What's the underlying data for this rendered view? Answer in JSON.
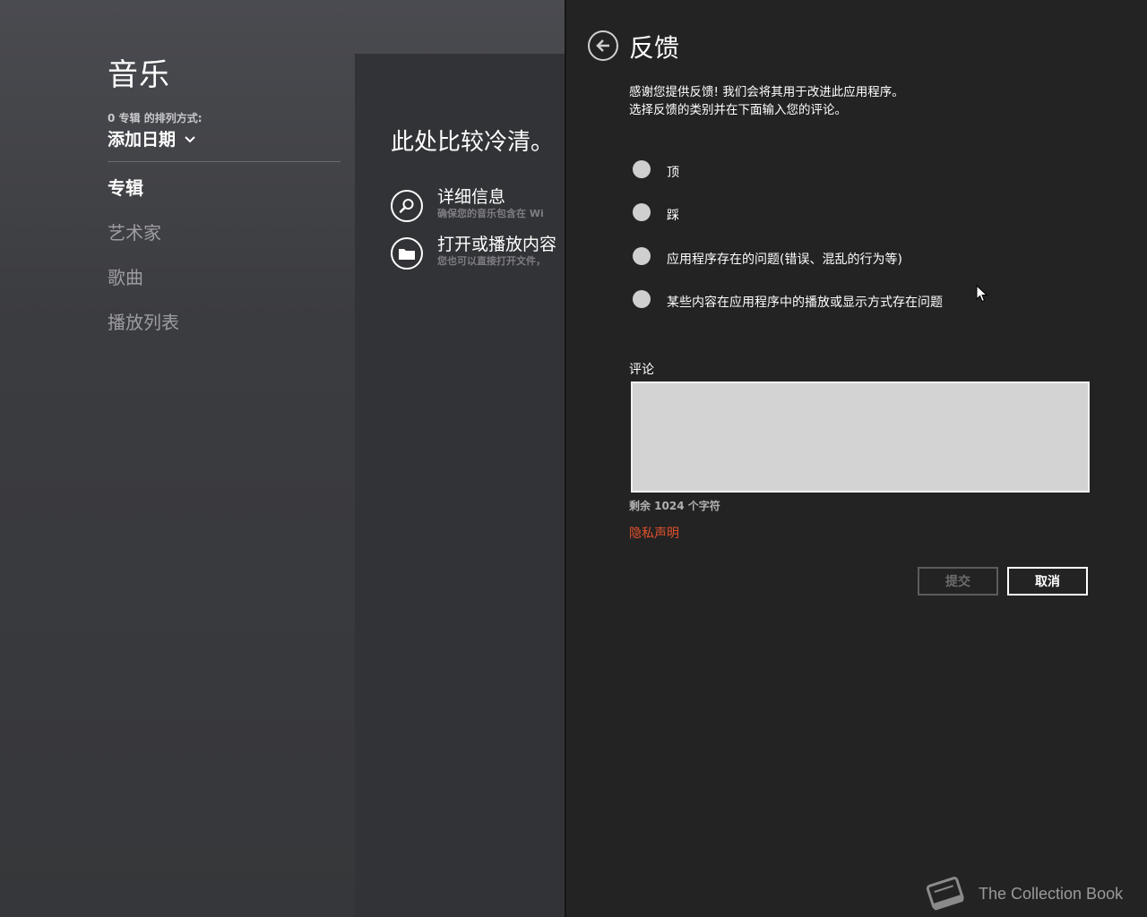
{
  "app": {
    "title": "音乐",
    "sort_caption": "0 专辑 的排列方式:",
    "sort_value": "添加日期",
    "nav_items": [
      {
        "label": "专辑",
        "active": true
      },
      {
        "label": "艺术家",
        "active": false
      },
      {
        "label": "歌曲",
        "active": false
      },
      {
        "label": "播放列表",
        "active": false
      }
    ]
  },
  "content": {
    "empty_title": "此处比较冷清。",
    "actions": [
      {
        "title": "详细信息",
        "subtitle": "确保您的音乐包含在 Wi",
        "icon": "search-icon"
      },
      {
        "title": "打开或播放内容",
        "subtitle": "您也可以直接打开文件，",
        "icon": "folder-icon"
      }
    ]
  },
  "feedback": {
    "title": "反馈",
    "desc_line1": "感谢您提供反馈! 我们会将其用于改进此应用程序。",
    "desc_line2": "选择反馈的类别并在下面输入您的评论。",
    "options": [
      {
        "label": "顶"
      },
      {
        "label": "踩"
      },
      {
        "label": "应用程序存在的问题(错误、混乱的行为等)"
      },
      {
        "label": "某些内容在应用程序中的播放或显示方式存在问题"
      }
    ],
    "comment_label": "评论",
    "comment_value": "",
    "char_count": "剩余 1024 个字符",
    "privacy_link": "隐私声明",
    "submit_label": "提交",
    "cancel_label": "取消"
  },
  "watermark": {
    "text": "The Collection Book"
  },
  "colors": {
    "flyout_bg": "#232323",
    "accent_link": "#e0502b",
    "radio_fill": "#cfcfcf"
  }
}
